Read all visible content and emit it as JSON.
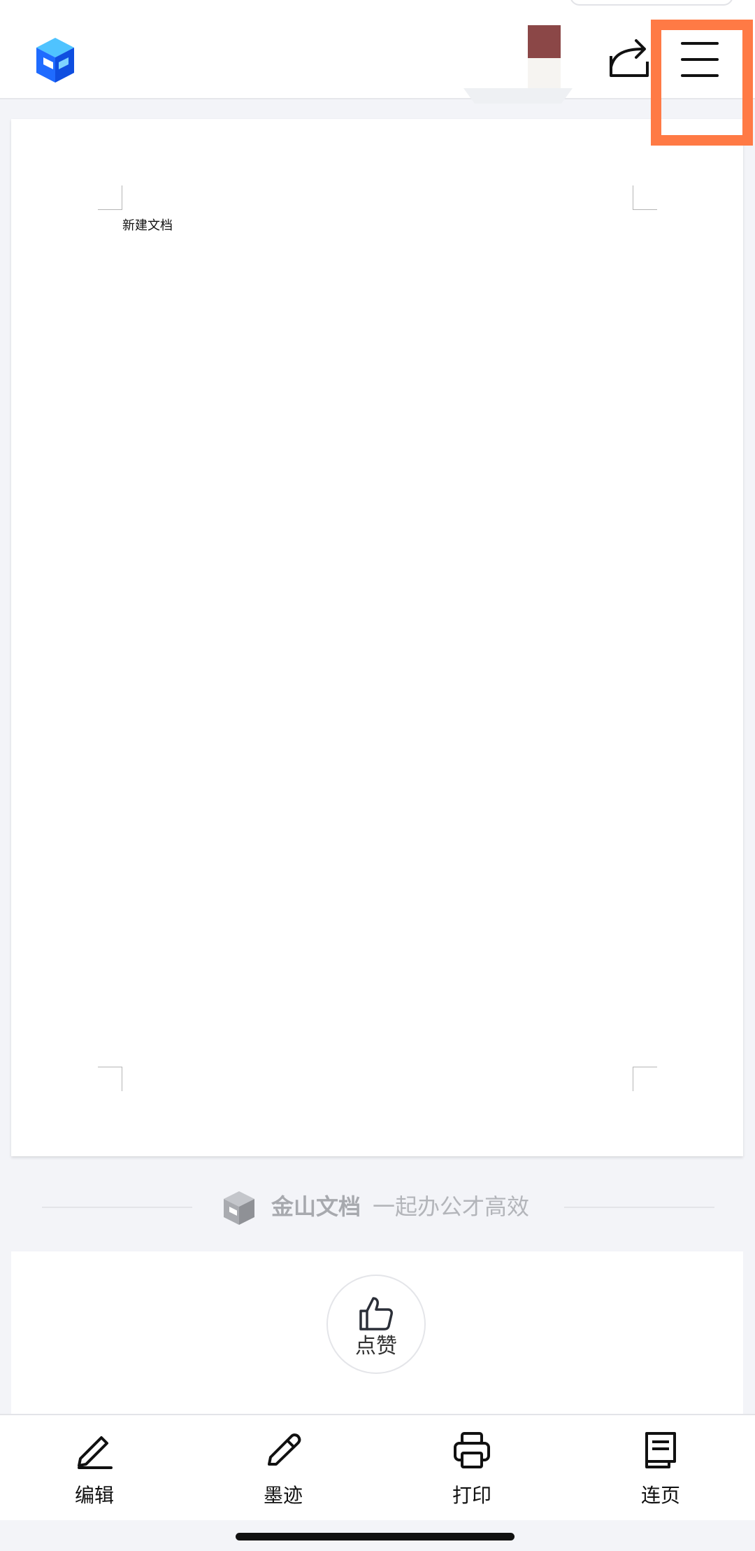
{
  "document": {
    "body_text": "新建文档"
  },
  "brand": {
    "name": "金山文档",
    "slogan": "一起办公才高效"
  },
  "like": {
    "label": "点赞"
  },
  "toolbar": {
    "edit_label": "编辑",
    "ink_label": "墨迹",
    "print_label": "打印",
    "continuous_label": "连页"
  },
  "colors": {
    "accent_highlight": "#ff7a45",
    "logo_blue": "#1f6bff",
    "avatar_top": "#8b4747",
    "background": "#f3f4f8"
  },
  "icons": {
    "app": "kdocs-logo-icon",
    "share": "share-icon",
    "menu": "menu-icon",
    "like": "thumbs-up-icon",
    "edit": "edit-pencil-icon",
    "ink": "ink-pen-icon",
    "print": "printer-icon",
    "continuous": "continuous-page-icon"
  }
}
